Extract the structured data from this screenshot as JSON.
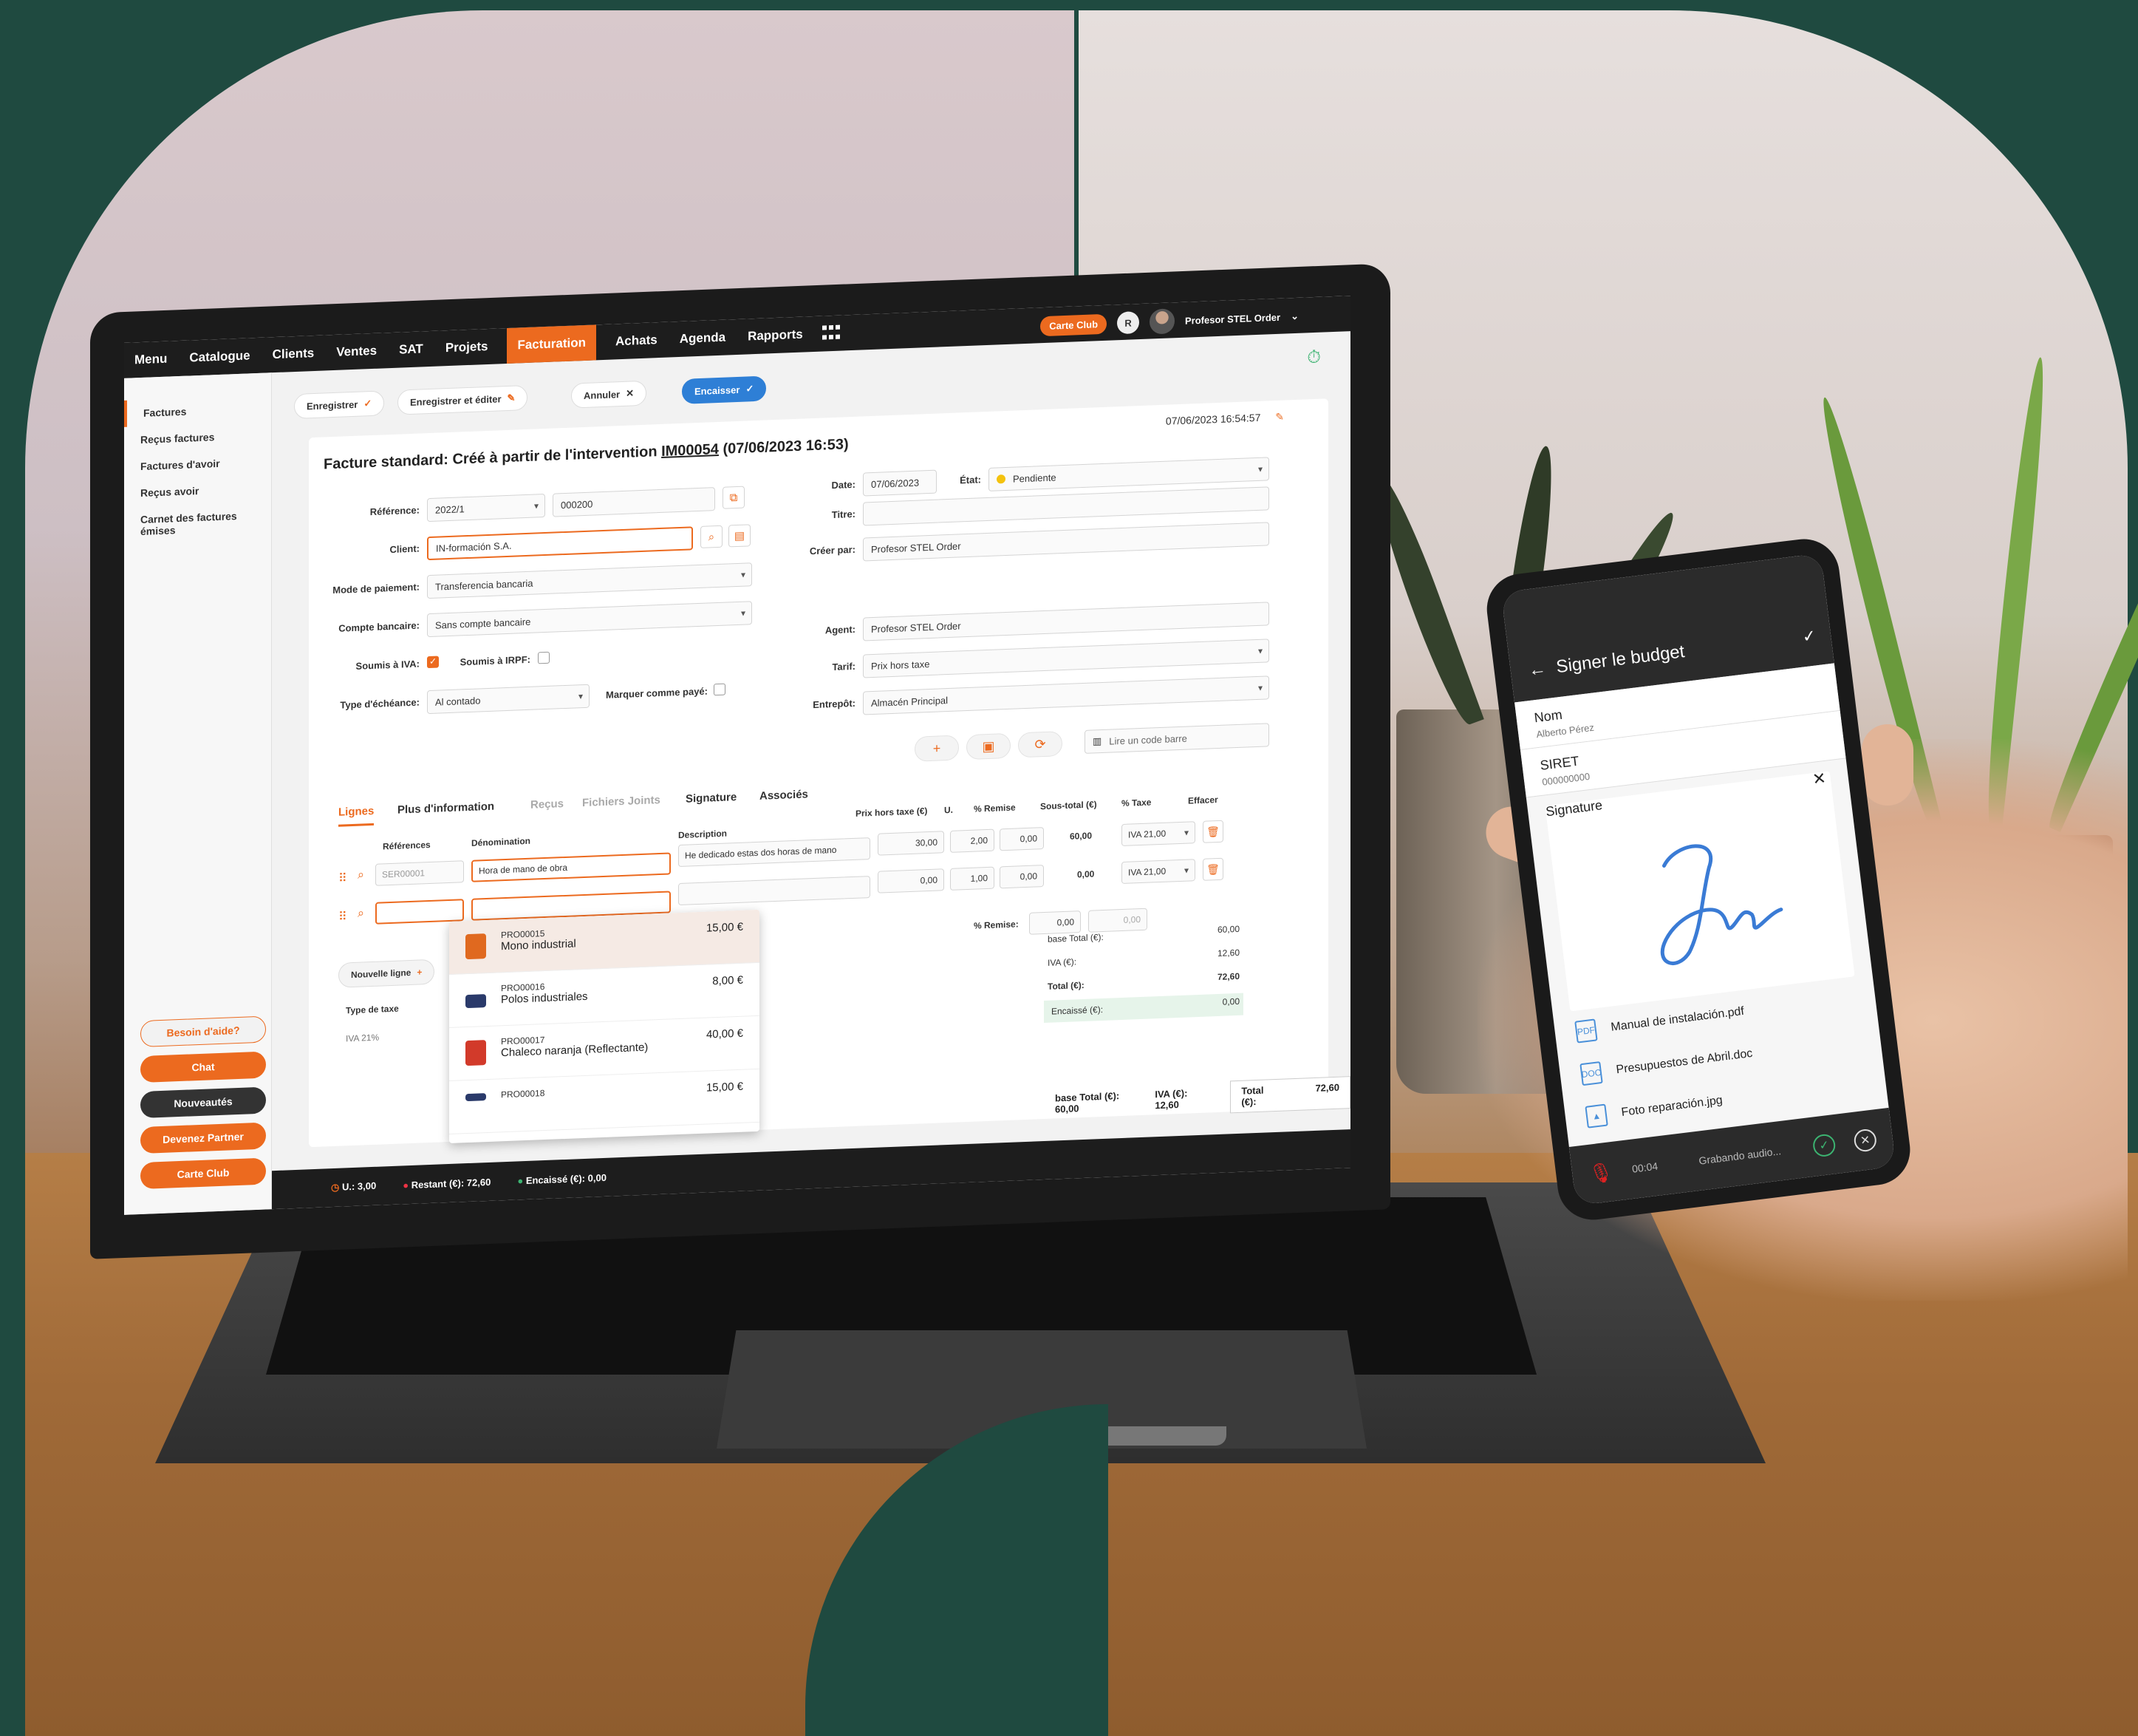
{
  "nav": {
    "items": [
      "Menu",
      "Catalogue",
      "Clients",
      "Ventes",
      "SAT",
      "Projets",
      "Facturation",
      "Achats",
      "Agenda",
      "Rapports"
    ],
    "active": "Facturation",
    "carte_club": "Carte Club",
    "avatar_initial": "R",
    "user": "Profesor STEL Order"
  },
  "sidebar": {
    "items": [
      "Factures",
      "Reçus factures",
      "Factures d'avoir",
      "Reçus avoir",
      "Carnet des factures émises"
    ],
    "buttons": {
      "help": "Besoin d'aide?",
      "chat": "Chat",
      "news": "Nouveautés",
      "partner": "Devenez Partner",
      "club": "Carte Club"
    }
  },
  "toolbar": {
    "save": "Enregistrer",
    "save_edit": "Enregistrer et éditer",
    "cancel": "Annuler",
    "collect": "Encaisser"
  },
  "form": {
    "title_prefix": "Facture standard: Créé à partir de l'intervention ",
    "title_link": "IM00054",
    "title_suffix": " (07/06/2023 16:53)",
    "timestamp": "07/06/2023 16:54:57",
    "labels": {
      "reference": "Référence:",
      "client": "Client:",
      "payment": "Mode de paiement:",
      "bank": "Compte bancaire:",
      "iva": "Soumis à IVA:",
      "irpf": "Soumis à IRPF:",
      "due": "Type d'échéance:",
      "paid": "Marquer comme payé:",
      "date": "Date:",
      "state": "État:",
      "titre": "Titre:",
      "creator": "Créer par:",
      "agent": "Agent:",
      "tarif": "Tarif:",
      "warehouse": "Entrepôt:"
    },
    "values": {
      "ref_series": "2022/1",
      "ref_number": "000200",
      "client": "IN-formación S.A.",
      "payment": "Transferencia bancaria",
      "bank": "Sans compte bancaire",
      "due": "Al contado",
      "date": "07/06/2023",
      "state": "Pendiente",
      "creator": "Profesor STEL Order",
      "agent": "Profesor STEL Order",
      "tarif": "Prix hors taxe",
      "warehouse": "Almacén Principal",
      "barcode_placeholder": "Lire un code barre"
    }
  },
  "tabs": [
    "Lignes",
    "Plus d'information",
    "Reçus",
    "Fichiers Joints",
    "Signature",
    "Associés"
  ],
  "lines": {
    "headers": {
      "ref": "Références",
      "name": "Dénomination",
      "desc": "Description",
      "price": "Prix hors taxe (€)",
      "u": "U.",
      "disc": "% Remise",
      "sub": "Sous-total (€)",
      "tax": "% Taxe",
      "del": "Effacer"
    },
    "rows": [
      {
        "ref": "SER00001",
        "name": "Hora de mano de obra",
        "desc": "He dedicado estas dos horas de mano",
        "price": "30,00",
        "u": "2,00",
        "disc": "0,00",
        "sub": "60,00",
        "tax": "IVA 21,00"
      },
      {
        "ref": "",
        "name": "",
        "desc": "",
        "price": "0,00",
        "u": "1,00",
        "disc": "0,00",
        "sub": "0,00",
        "tax": "IVA 21,00"
      }
    ],
    "new_line": "Nouvelle ligne",
    "tax_type_label": "Type de taxe",
    "tax_type_value": "IVA 21%",
    "discount_label": "% Remise:",
    "discount_values": [
      "0,00",
      "0,00"
    ]
  },
  "dropdown": [
    {
      "code": "PRO00015",
      "name": "Mono industrial",
      "price": "15,00 €"
    },
    {
      "code": "PRO00016",
      "name": "Polos industriales",
      "price": "8,00 €"
    },
    {
      "code": "PRO00017",
      "name": "Chaleco naranja (Reflectante)",
      "price": "40,00 €"
    },
    {
      "code": "PRO00018",
      "name": "",
      "price": "15,00 €"
    }
  ],
  "summary": {
    "base_label": "base Total (€):",
    "base": "60,00",
    "iva_label": "IVA (€):",
    "iva": "12,60",
    "total_label": "Total (€):",
    "total": "72,60",
    "paid_label": "Encaissé (€):",
    "paid": "0,00"
  },
  "bottom": {
    "units": "U.: 3,00",
    "remaining": "Restant (€): 72,60",
    "collected": "Encaissé (€): 0,00",
    "base": "base Total (€): 60,00",
    "iva": "IVA (€): 12,60",
    "total_label": "Total (€):",
    "total": "72,60"
  },
  "phone": {
    "title": "Signer le budget",
    "name_label": "Nom",
    "name_value": "Alberto Pérez",
    "siret_label": "SIRET",
    "siret_value": "000000000",
    "signature_label": "Signature",
    "files": [
      "Manual de instalación.pdf",
      "Presupuestos de Abril.doc",
      "Foto reparación.jpg"
    ],
    "rec_time": "00:04",
    "rec_text": "Grabando audio..."
  },
  "colors": {
    "accent": "#ec6a1f",
    "blue": "#2e7fd6",
    "background": "#1f4a40"
  }
}
